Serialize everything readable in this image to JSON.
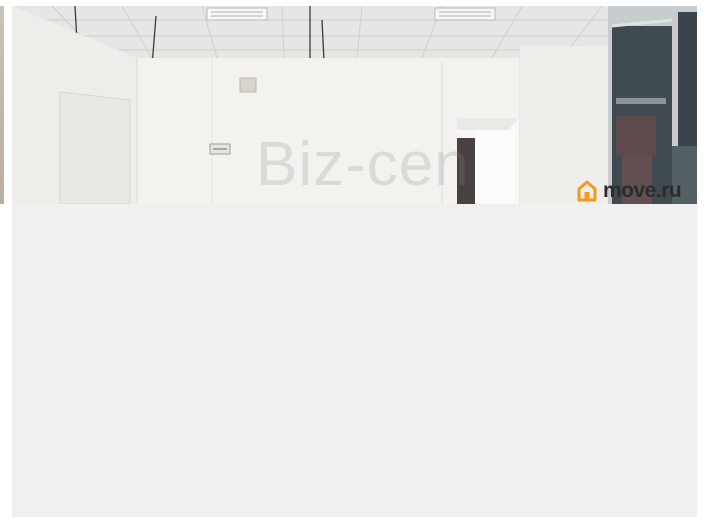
{
  "watermark": {
    "text": "Biz-cen"
  },
  "brand": {
    "name": "move.ru",
    "icon": "house-logo-icon",
    "color": "#f29a1c"
  },
  "colors": {
    "placeholder_bg": "#f0f0f0",
    "wall": "#f3f2ef",
    "ceiling": "#e8e8e6",
    "glass": "#3e4a50"
  }
}
